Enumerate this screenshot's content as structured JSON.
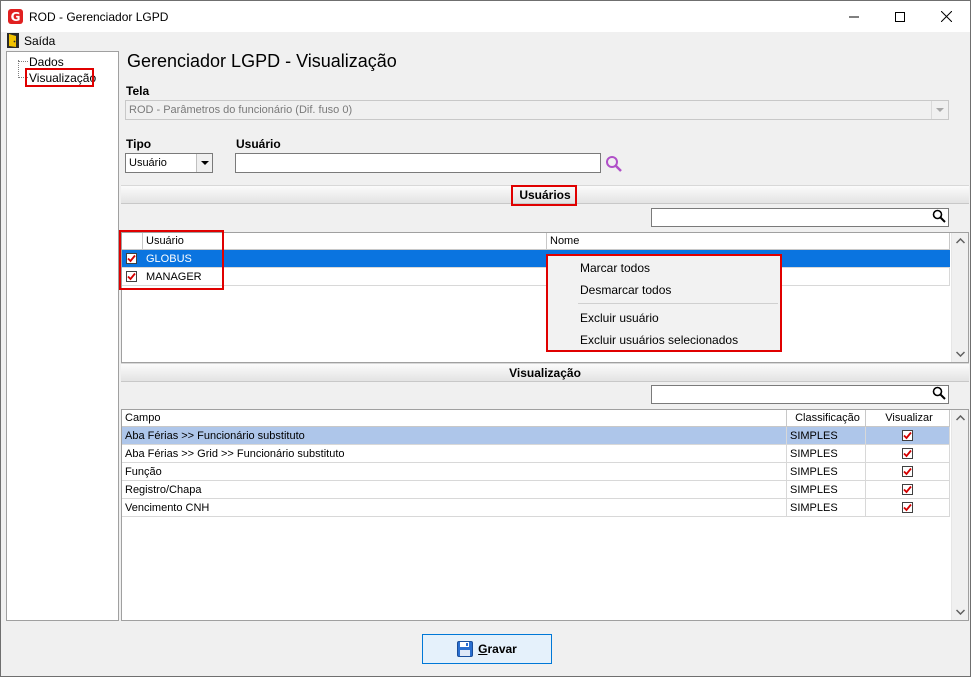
{
  "window": {
    "title": "ROD - Gerenciador LGPD",
    "logo_letter": "G",
    "controls": [
      "minimize",
      "maximize",
      "close"
    ]
  },
  "menu": {
    "exit_label": "Saída"
  },
  "tree": {
    "items": [
      {
        "label": "Dados"
      },
      {
        "label": "Visualização",
        "selected": true
      }
    ]
  },
  "page": {
    "title": "Gerenciador LGPD - Visualização"
  },
  "form": {
    "tela_label": "Tela",
    "tela_value": "ROD - Parâmetros do funcionário (Dif. fuso 0)",
    "tipo_label": "Tipo",
    "tipo_value": "Usuário",
    "usuario_label": "Usuário",
    "usuario_value": ""
  },
  "usuarios": {
    "section_title": "Usuários",
    "filter_value": "",
    "columns": [
      "Usuário",
      "Nome"
    ],
    "rows": [
      {
        "usuario": "GLOBUS",
        "nome": "",
        "checked": true,
        "selected": true
      },
      {
        "usuario": "MANAGER",
        "nome": "",
        "checked": true,
        "selected": false
      }
    ]
  },
  "context_menu": {
    "items": [
      "Marcar todos",
      "Desmarcar todos",
      "Excluir usuário",
      "Excluir usuários selecionados"
    ]
  },
  "visualizacao": {
    "section_title": "Visualização",
    "filter_value": "",
    "columns": [
      "Campo",
      "Classificação",
      "Visualizar"
    ],
    "rows": [
      {
        "campo": "Aba Férias >> Funcionário substituto",
        "classificacao": "SIMPLES",
        "visualizar": true,
        "selected": true
      },
      {
        "campo": "Aba Férias >> Grid >> Funcionário substituto",
        "classificacao": "SIMPLES",
        "visualizar": true
      },
      {
        "campo": "Função",
        "classificacao": "SIMPLES",
        "visualizar": true
      },
      {
        "campo": "Registro/Chapa",
        "classificacao": "SIMPLES",
        "visualizar": true
      },
      {
        "campo": "Vencimento CNH",
        "classificacao": "SIMPLES",
        "visualizar": true
      }
    ]
  },
  "footer": {
    "save_label_first": "G",
    "save_label_rest": "ravar"
  },
  "colors": {
    "highlight_red": "#e00000",
    "selection_blue": "#0a74e0",
    "row_selected": "#aec6ea",
    "check_red": "#d40000"
  }
}
